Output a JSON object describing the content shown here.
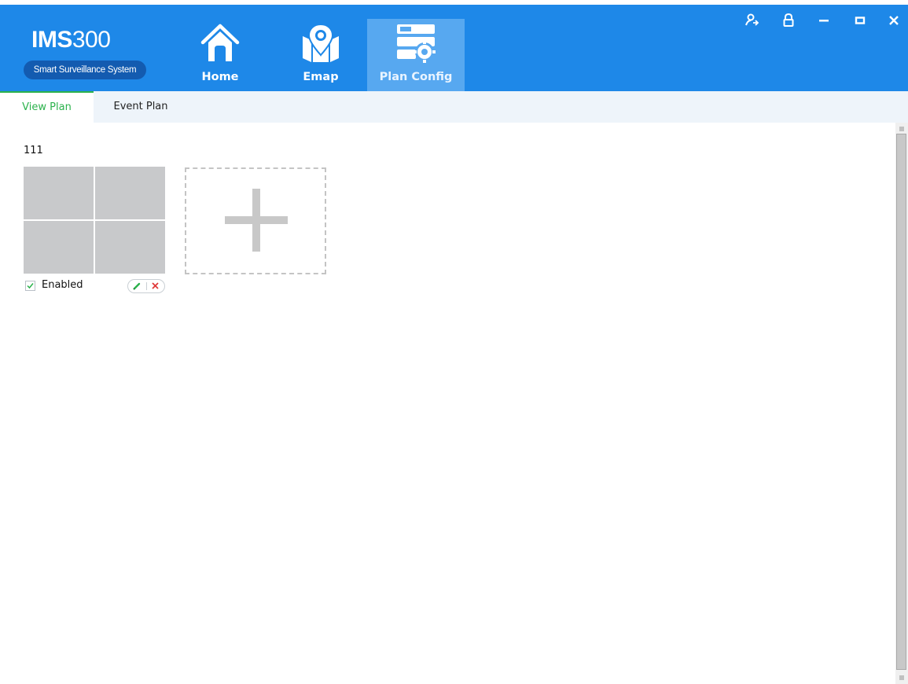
{
  "app": {
    "brand_main": "IMS",
    "brand_num": "300",
    "brand_sub": "Smart Surveillance System",
    "colors": {
      "titlebar": "#1e88e8",
      "active_nav": "#57a8f0",
      "accent_green": "#2bb24c"
    }
  },
  "nav": {
    "items": [
      {
        "label": "Home",
        "icon": "home-icon"
      },
      {
        "label": "Emap",
        "icon": "map-pin-icon"
      },
      {
        "label": "Plan Config",
        "icon": "plan-config-icon",
        "active": true
      }
    ]
  },
  "window": {
    "controls": [
      "user-switch-icon",
      "lock-icon",
      "minimize-icon",
      "maximize-icon",
      "close-icon"
    ]
  },
  "tabs": [
    {
      "label": "View Plan",
      "active": true
    },
    {
      "label": "Event Plan",
      "active": false
    }
  ],
  "plans": [
    {
      "name": "111",
      "enabled_label": "Enabled",
      "enabled": true,
      "layout": "2x2"
    }
  ],
  "add_plan": {
    "icon": "plus-icon"
  }
}
